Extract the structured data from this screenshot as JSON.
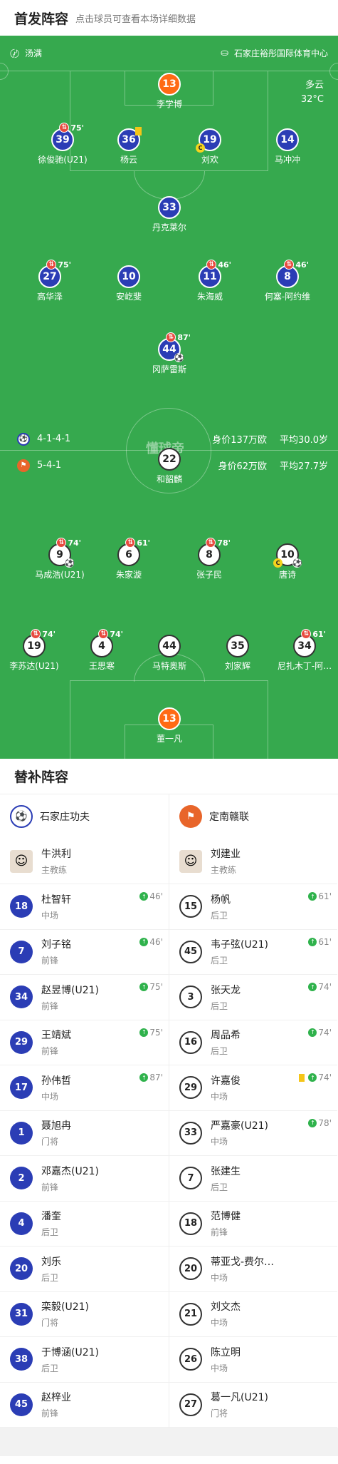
{
  "header": {
    "title": "首发阵容",
    "subtitle": "点击球员可查看本场详细数据"
  },
  "pitch": {
    "referee": "汤满",
    "stadium": "石家庄裕彤国际体育中心",
    "weather": "多云",
    "temperature": "32°C",
    "watermark": "懂球帝",
    "home_team": {
      "formation": "4-1-4-1",
      "value": "身价137万欧",
      "avg_age": "平均30.0岁"
    },
    "away_team": {
      "formation": "5-4-1",
      "value": "身价62万欧",
      "avg_age": "平均27.7岁"
    }
  },
  "colors": {
    "pitch": "#36a94e",
    "home": "#2b3db5",
    "keeper": "#ff6a14",
    "sub_out": "#e84a3f",
    "sub_in": "#2fb24c",
    "card": "#f5c518"
  },
  "home_lineup": [
    {
      "num": "13",
      "name": "李学博",
      "gk": true
    },
    {
      "num": "39",
      "name": "徐俊驰(U21)",
      "sub": "75'"
    },
    {
      "num": "36",
      "name": "杨云",
      "card": true
    },
    {
      "num": "19",
      "name": "刘欢",
      "captain": true
    },
    {
      "num": "14",
      "name": "马冲冲"
    },
    {
      "num": "33",
      "name": "丹克莱尔"
    },
    {
      "num": "27",
      "name": "高华泽",
      "sub": "75'"
    },
    {
      "num": "10",
      "name": "安屹斐"
    },
    {
      "num": "11",
      "name": "朱海威",
      "sub": "46'"
    },
    {
      "num": "8",
      "name": "何塞-阿约维",
      "sub": "46'"
    },
    {
      "num": "44",
      "name": "冈萨雷斯",
      "sub": "87'",
      "goal": true
    }
  ],
  "away_lineup": [
    {
      "num": "22",
      "name": "和韶麟"
    },
    {
      "num": "9",
      "name": "马成浩(U21)",
      "sub": "74'",
      "goal": true
    },
    {
      "num": "6",
      "name": "朱家漩",
      "sub": "61'"
    },
    {
      "num": "8",
      "name": "张子民",
      "sub": "78'"
    },
    {
      "num": "10",
      "name": "唐诗",
      "captain": true,
      "goal": true
    },
    {
      "num": "19",
      "name": "李苏达(U21)",
      "sub": "74'"
    },
    {
      "num": "4",
      "name": "王思寒",
      "sub": "74'"
    },
    {
      "num": "44",
      "name": "马特奥斯"
    },
    {
      "num": "35",
      "name": "刘家辉"
    },
    {
      "num": "34",
      "name": "尼扎木丁-阿…",
      "sub": "61'"
    },
    {
      "num": "13",
      "name": "董一凡",
      "gk": true
    }
  ],
  "subs": {
    "title": "替补阵容",
    "home": {
      "team": "石家庄功夫",
      "coach": {
        "name": "牛洪利",
        "role": "主教练"
      },
      "players": [
        {
          "num": "18",
          "name": "杜智轩",
          "pos": "中场",
          "in": "46'"
        },
        {
          "num": "7",
          "name": "刘子铭",
          "pos": "前锋",
          "in": "46'"
        },
        {
          "num": "34",
          "name": "赵昱博(U21)",
          "pos": "前锋",
          "in": "75'"
        },
        {
          "num": "29",
          "name": "王靖斌",
          "pos": "前锋",
          "in": "75'"
        },
        {
          "num": "17",
          "name": "孙伟哲",
          "pos": "中场",
          "in": "87'"
        },
        {
          "num": "1",
          "name": "聂旭冉",
          "pos": "门将"
        },
        {
          "num": "2",
          "name": "邓嘉杰(U21)",
          "pos": "前锋"
        },
        {
          "num": "4",
          "name": "潘奎",
          "pos": "后卫"
        },
        {
          "num": "20",
          "name": "刘乐",
          "pos": "后卫"
        },
        {
          "num": "31",
          "name": "栾毅(U21)",
          "pos": "门将"
        },
        {
          "num": "38",
          "name": "于博涵(U21)",
          "pos": "后卫"
        },
        {
          "num": "45",
          "name": "赵梓业",
          "pos": "前锋"
        }
      ]
    },
    "away": {
      "team": "定南赣联",
      "coach": {
        "name": "刘建业",
        "role": "主教练"
      },
      "players": [
        {
          "num": "15",
          "name": "杨帆",
          "pos": "后卫",
          "in": "61'"
        },
        {
          "num": "45",
          "name": "韦子弦(U21)",
          "pos": "后卫",
          "in": "61'"
        },
        {
          "num": "3",
          "name": "张天龙",
          "pos": "后卫",
          "in": "74'"
        },
        {
          "num": "16",
          "name": "周品希",
          "pos": "后卫",
          "in": "74'"
        },
        {
          "num": "29",
          "name": "许嘉俊",
          "pos": "中场",
          "in": "74'",
          "card": true
        },
        {
          "num": "33",
          "name": "严嘉豪(U21)",
          "pos": "中场",
          "in": "78'"
        },
        {
          "num": "7",
          "name": "张建生",
          "pos": "后卫"
        },
        {
          "num": "18",
          "name": "范博健",
          "pos": "前锋"
        },
        {
          "num": "20",
          "name": "蒂亚戈-费尔…",
          "pos": "中场"
        },
        {
          "num": "21",
          "name": "刘文杰",
          "pos": "中场"
        },
        {
          "num": "26",
          "name": "陈立明",
          "pos": "中场"
        },
        {
          "num": "27",
          "name": "葛一凡(U21)",
          "pos": "门将"
        }
      ]
    }
  }
}
